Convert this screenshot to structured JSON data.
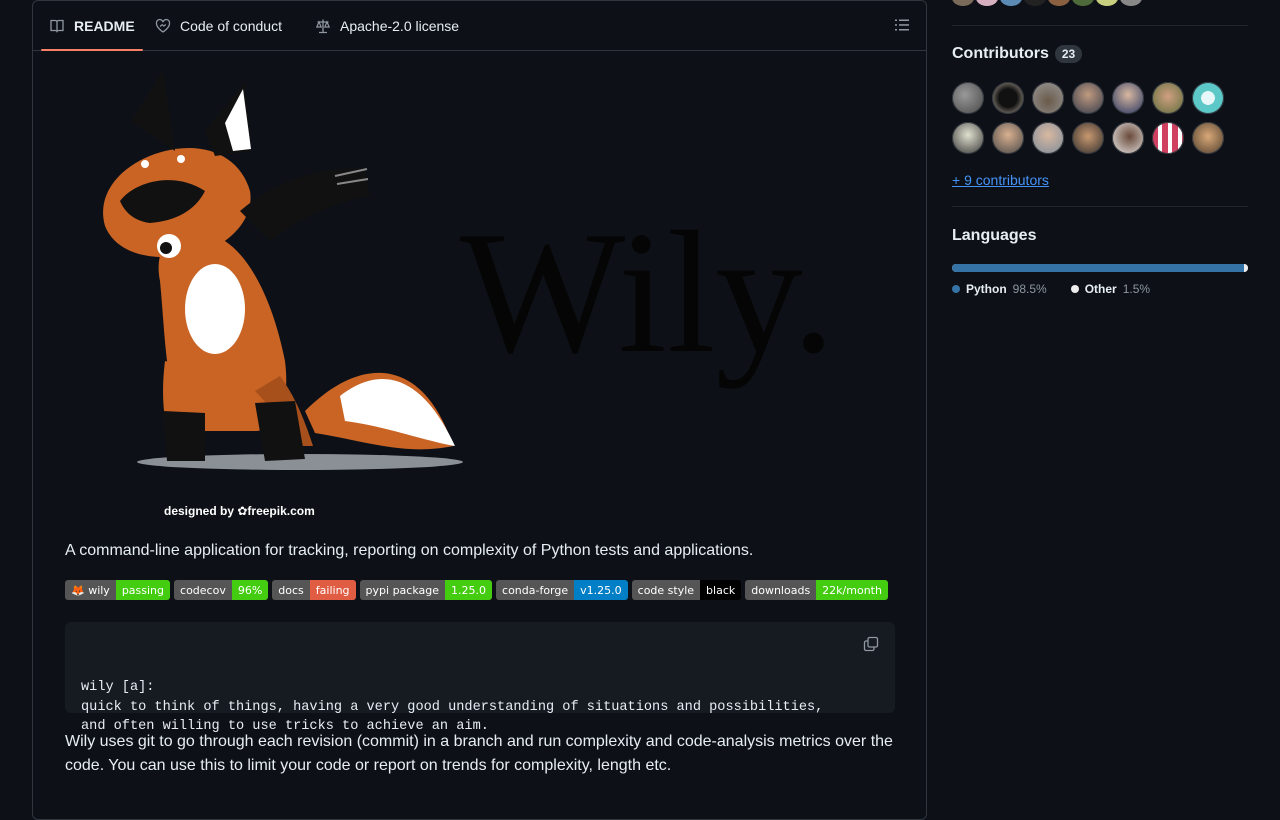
{
  "tabs": [
    {
      "label": "README",
      "icon": "book-icon",
      "active": true
    },
    {
      "label": "Code of conduct",
      "icon": "heart-icon",
      "active": false
    },
    {
      "label": "Apache-2.0 license",
      "icon": "law-icon",
      "active": false
    }
  ],
  "hero": {
    "wordmark": "Wily.",
    "credit_prefix": "designed by",
    "credit_brand": "freepik.com"
  },
  "readme": {
    "description": "A command-line application for tracking, reporting on complexity of Python tests and applications.",
    "badges": [
      {
        "left": "🦊 wily",
        "right": "passing",
        "color": "#44cc11"
      },
      {
        "left": "codecov",
        "right": "96%",
        "color": "#44cc11"
      },
      {
        "left": "docs",
        "right": "failing",
        "color": "#e05d44"
      },
      {
        "left": "pypi package",
        "right": "1.25.0",
        "color": "#44cc11"
      },
      {
        "left": "conda-forge",
        "right": "v1.25.0",
        "color": "#007ec6"
      },
      {
        "left": "code style",
        "right": "black",
        "color": "#000000"
      },
      {
        "left": "downloads",
        "right": "22k/month",
        "color": "#44cc11"
      }
    ],
    "code_block": "wily [a]:\nquick to think of things, having a very good understanding of situations and possibilities,\nand often willing to use tricks to achieve an aim.",
    "paragraph": "Wily uses git to go through each revision (commit) in a branch and run complexity and code-analysis metrics over the code. You can use this to limit your code or report on trends for complexity, length etc."
  },
  "sidebar": {
    "contributors_title": "Contributors",
    "contributors_count": "23",
    "more_contributors": "+ 9 contributors",
    "languages_title": "Languages",
    "languages": [
      {
        "name": "Python",
        "percent": "98.5%",
        "value": 98.5,
        "color": "#3572A5"
      },
      {
        "name": "Other",
        "percent": "1.5%",
        "value": 1.5,
        "color": "#ededed"
      }
    ]
  },
  "colors": {
    "accent_tab": "#f78166",
    "link": "#4493f8",
    "background": "#0d1117"
  }
}
